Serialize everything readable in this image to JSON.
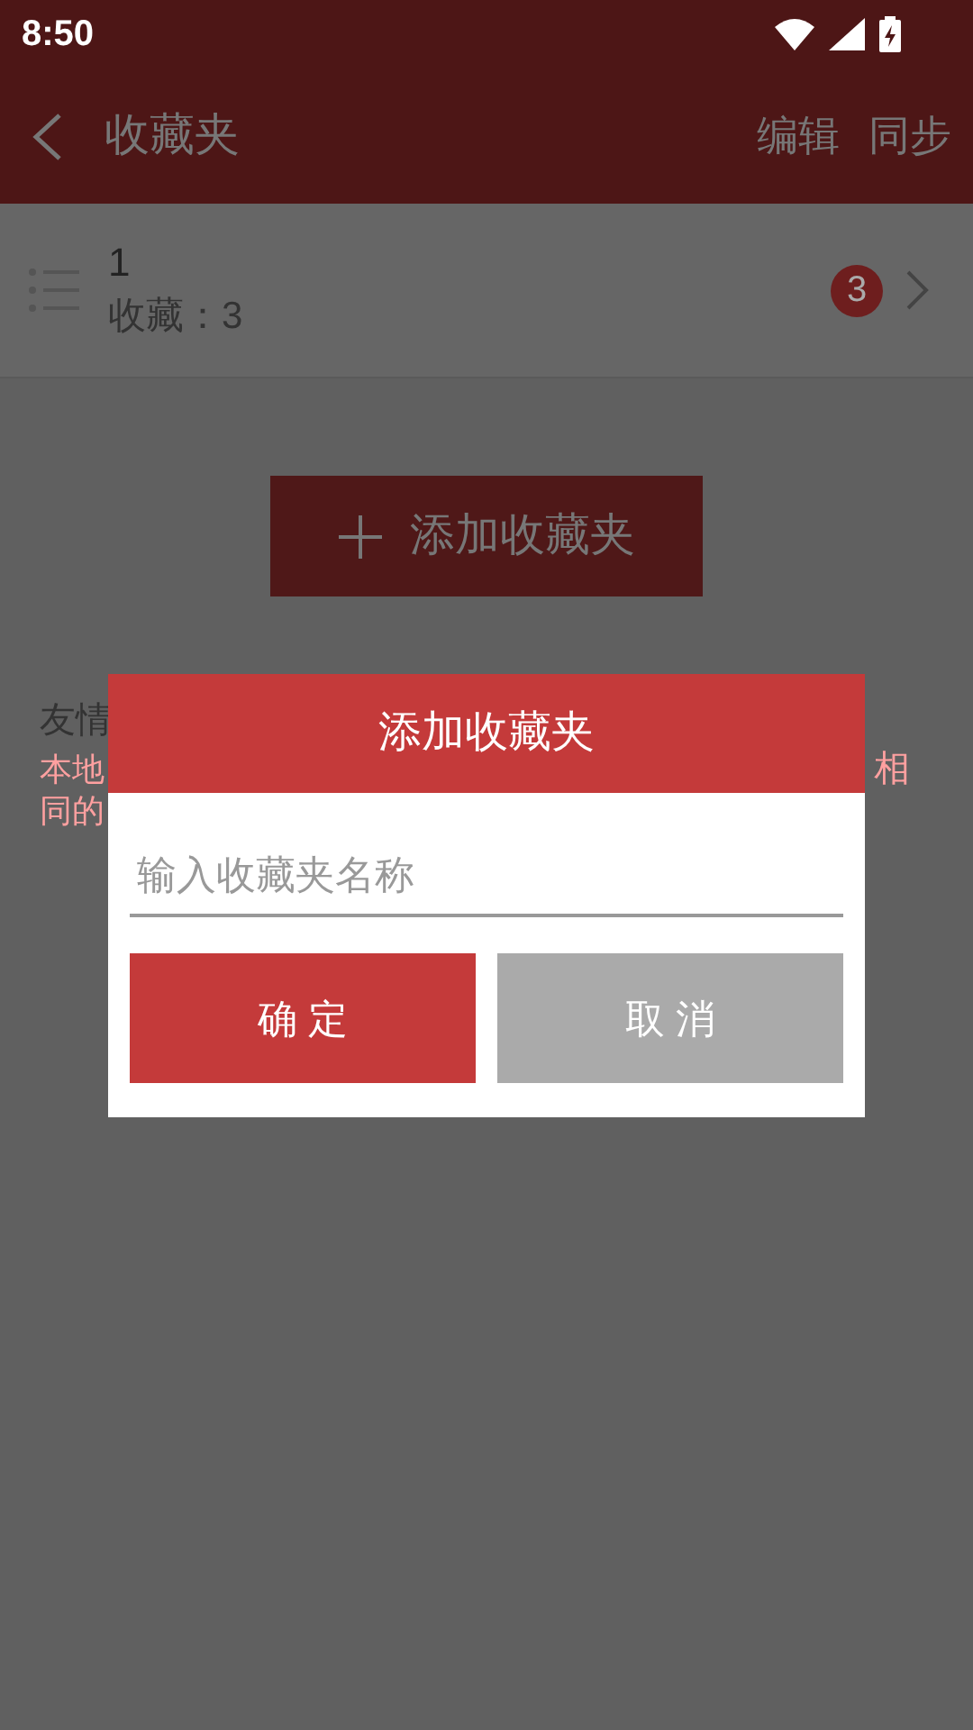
{
  "status_bar": {
    "time": "8:50"
  },
  "toolbar": {
    "title": "收藏夹",
    "actions": [
      "编辑",
      "同步"
    ]
  },
  "folders": [
    {
      "name": "1",
      "subtitle": "收藏：3",
      "count": "3"
    }
  ],
  "add_button": {
    "label": "添加收藏夹"
  },
  "notice": {
    "title": "友情",
    "line_1_left": "本地",
    "line_1_right": "相",
    "line_2_left": "同的"
  },
  "dialog": {
    "title": "添加收藏夹",
    "input": {
      "placeholder": "输入收藏夹名称"
    },
    "buttons": [
      {
        "label": "确 定",
        "kind": "primary"
      },
      {
        "label": "取 消",
        "kind": "secondary"
      }
    ]
  }
}
